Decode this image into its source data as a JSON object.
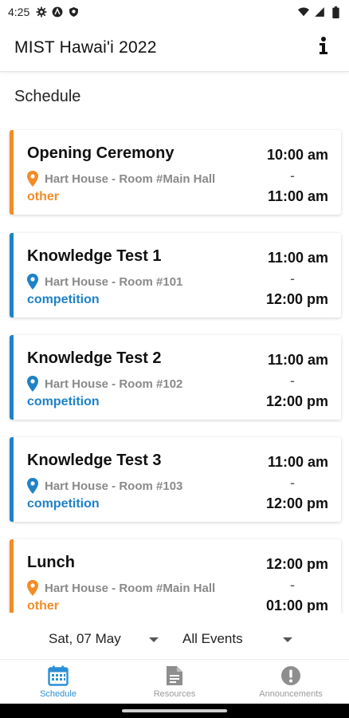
{
  "status_bar": {
    "time": "4:25",
    "left_icons": [
      "gear-icon",
      "signal-a-icon",
      "shield-icon"
    ],
    "right_icons": [
      "wifi-icon",
      "cell-signal-icon",
      "battery-icon"
    ]
  },
  "app_bar": {
    "title": "MIST Hawai'i 2022",
    "info_icon": "info-icon"
  },
  "section_title": "Schedule",
  "colors": {
    "other": "#f28c28",
    "competition": "#1f82c7",
    "active_tab": "#2b8fd6",
    "inactive_tab": "#9a9a9a"
  },
  "events": [
    {
      "title": "Opening Ceremony",
      "location": "Hart House - Room #Main Hall",
      "category": "other",
      "start": "10:00 am",
      "separator": "-",
      "end": "11:00 am"
    },
    {
      "title": "Knowledge Test 1",
      "location": "Hart House - Room #101",
      "category": "competition",
      "start": "11:00 am",
      "separator": "-",
      "end": "12:00 pm"
    },
    {
      "title": "Knowledge Test 2",
      "location": "Hart House - Room #102",
      "category": "competition",
      "start": "11:00 am",
      "separator": "-",
      "end": "12:00 pm"
    },
    {
      "title": "Knowledge Test 3",
      "location": "Hart House - Room #103",
      "category": "competition",
      "start": "11:00 am",
      "separator": "-",
      "end": "12:00 pm"
    },
    {
      "title": "Lunch",
      "location": "Hart House - Room #Main Hall",
      "category": "other",
      "start": "12:00 pm",
      "separator": "-",
      "end": "01:00 pm"
    }
  ],
  "filters": {
    "date_selected": "Sat, 07 May",
    "events_selected": "All Events"
  },
  "bottom_nav": [
    {
      "label": "Schedule",
      "icon": "calendar-icon",
      "active": true
    },
    {
      "label": "Resources",
      "icon": "document-icon",
      "active": false
    },
    {
      "label": "Announcements",
      "icon": "alert-icon",
      "active": false
    }
  ]
}
